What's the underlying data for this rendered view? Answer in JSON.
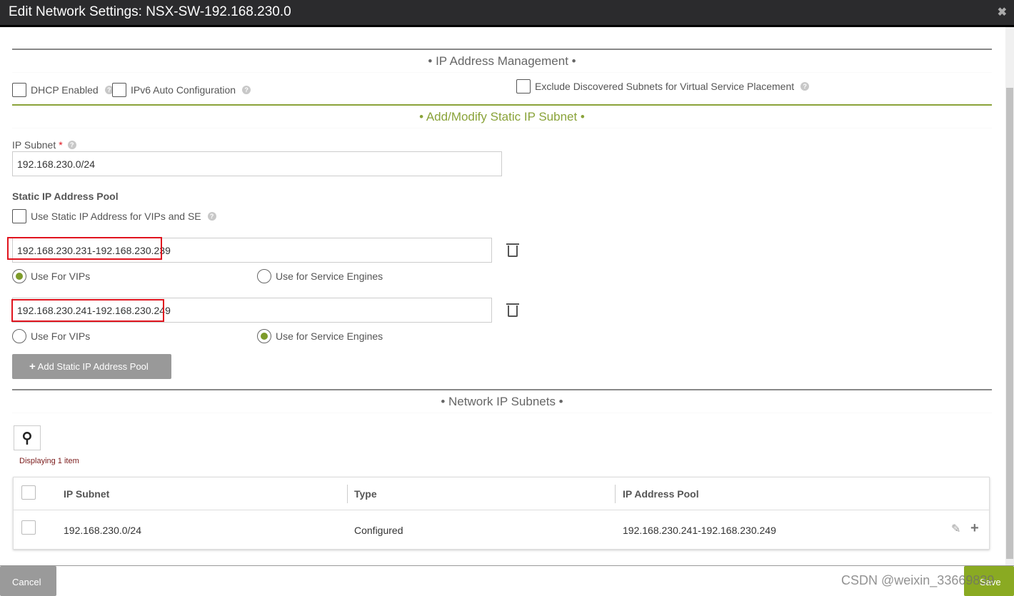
{
  "title": "Edit Network Settings: NSX-SW-192.168.230.0",
  "sections": {
    "ipam": "• IP Address Management •",
    "static": "• Add/Modify Static IP Subnet •",
    "subnets": "• Network IP Subnets •"
  },
  "options": {
    "dhcp": "DHCP Enabled",
    "ipv6": "IPv6 Auto Configuration",
    "exclude": "Exclude Discovered Subnets for Virtual Service Placement"
  },
  "ip_subnet": {
    "label": "IP Subnet",
    "required": "*",
    "value": "192.168.230.0/24"
  },
  "pool": {
    "heading": "Static IP Address Pool",
    "use_static": "Use Static IP Address for VIPs and SE",
    "ranges": [
      {
        "value": "192.168.230.231-192.168.230.239",
        "vips": "Use For VIPs",
        "se": "Use for Service Engines",
        "selected": "vips"
      },
      {
        "value": "192.168.230.241-192.168.230.249",
        "vips": "Use For VIPs",
        "se": "Use for Service Engines",
        "selected": "se"
      }
    ],
    "add_button": "Add Static IP Address Pool"
  },
  "grid": {
    "count_text": "Displaying 1 item",
    "headers": [
      "IP Subnet",
      "Type",
      "IP Address Pool"
    ],
    "rows": [
      {
        "subnet": "192.168.230.0/24",
        "type": "Configured",
        "pool": "192.168.230.241-192.168.230.249"
      }
    ]
  },
  "footer": {
    "cancel": "Cancel",
    "save": "Save",
    "watermark": "CSDN @weixin_33669839"
  },
  "colors": {
    "accent": "#8aa33a",
    "highlight": "#e0141e"
  }
}
